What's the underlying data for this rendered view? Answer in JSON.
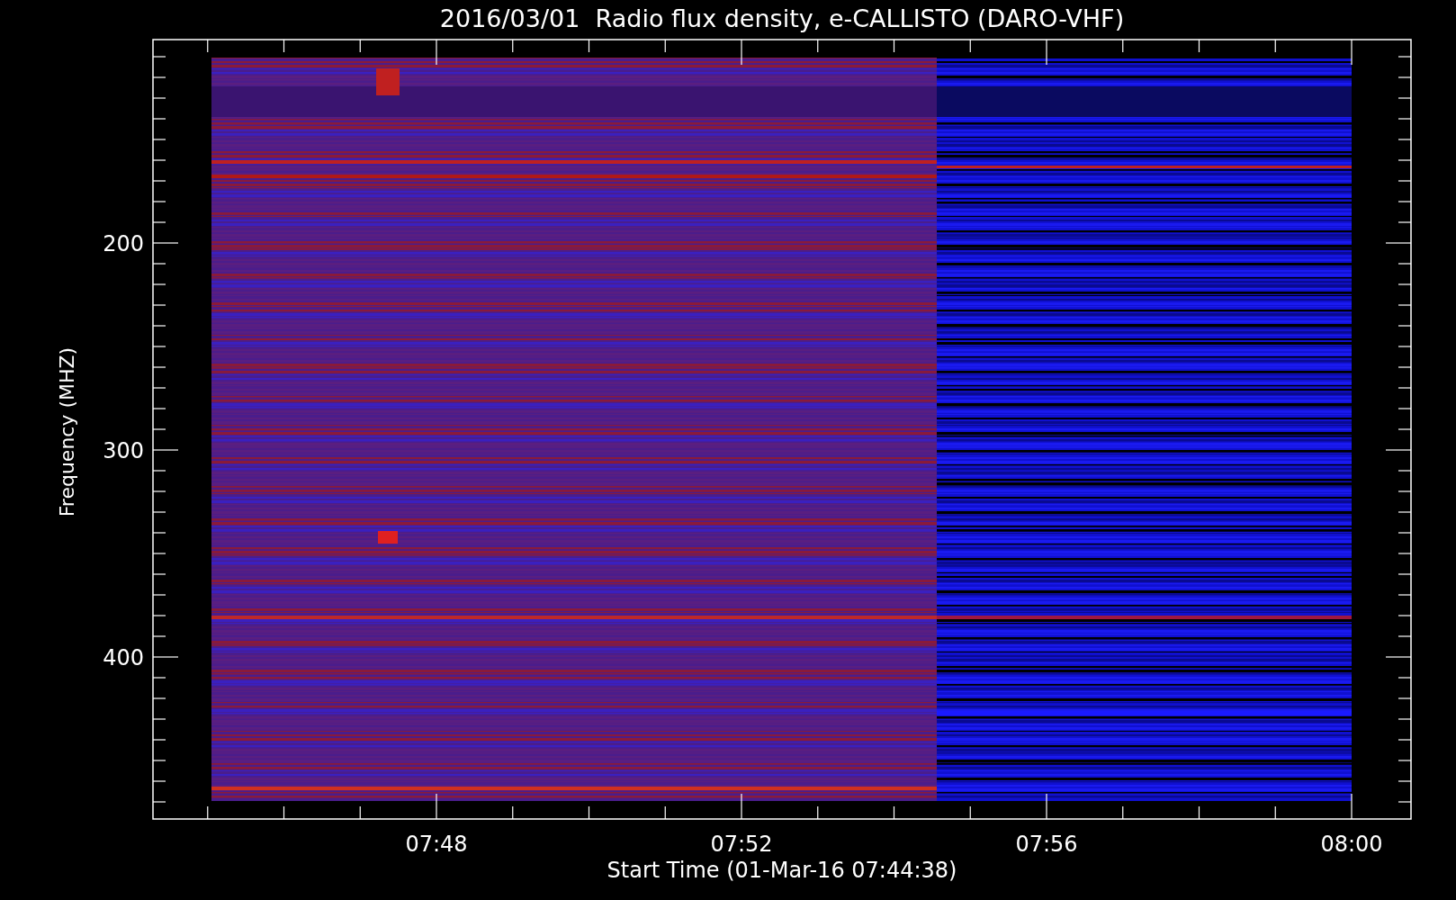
{
  "title": "2016/03/01  Radio flux density, e-CALLISTO (DARO-VHF)",
  "ylabel": "Frequency (MHZ)",
  "xlabel": "Start Time (01-Mar-16 07:44:38)",
  "yticks": [
    "200",
    "300",
    "400"
  ],
  "xticks": [
    "07:48",
    "07:52",
    "07:56",
    "08:00"
  ]
}
